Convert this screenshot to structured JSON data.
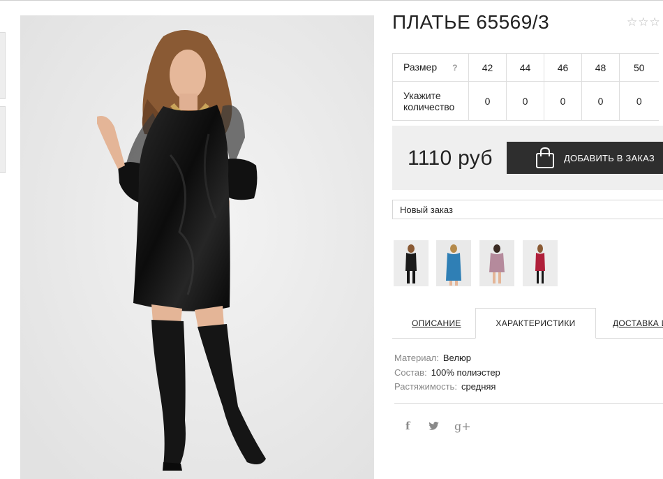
{
  "product": {
    "title": "ПЛАТЬЕ 65569/3",
    "rating_stars": "☆☆☆",
    "price": "1110 руб",
    "add_button_label": "ДОБАВИТЬ В ЗАКАЗ"
  },
  "size_table": {
    "size_label": "Размер",
    "help_mark": "?",
    "qty_label": "Укажите количество",
    "sizes": [
      "42",
      "44",
      "46",
      "48",
      "50"
    ],
    "quantities": [
      "0",
      "0",
      "0",
      "0",
      "0"
    ]
  },
  "order": {
    "selected": "Новый заказ"
  },
  "color_thumbs": [
    {
      "name": "black",
      "dress_color": "#1a1a1a"
    },
    {
      "name": "blue",
      "dress_color": "#2f7fb5"
    },
    {
      "name": "pink",
      "dress_color": "#b58a9c"
    },
    {
      "name": "red",
      "dress_color": "#b01f3a"
    }
  ],
  "tabs": {
    "description": "ОПИСАНИЕ",
    "characteristics": "ХАРАКТЕРИСТИКИ",
    "delivery": "ДОСТАВКА И"
  },
  "characteristics": [
    {
      "key": "Материал:",
      "value": "Велюр"
    },
    {
      "key": "Состав:",
      "value": "100% полиэстер"
    },
    {
      "key": "Растяжимость:",
      "value": "средняя"
    }
  ],
  "social": {
    "facebook": "f",
    "twitter": "t",
    "google": "g+"
  },
  "icons": {
    "cart": "shopping-bag-icon",
    "star": "star-icon"
  },
  "colors": {
    "button_bg": "#2e2e2e",
    "price_box_bg": "#efefef",
    "photo_bg": "#ececec"
  }
}
